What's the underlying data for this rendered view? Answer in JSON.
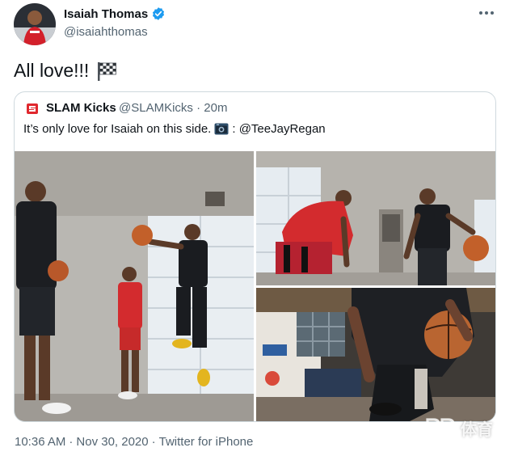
{
  "author": {
    "display_name": "Isaiah Thomas",
    "handle": "@isaiahthomas",
    "verified": true
  },
  "tweet": {
    "text": "All love!!!",
    "emoji_icon": "checkered-flag"
  },
  "quote": {
    "display_name": "SLAM Kicks",
    "handle": "@SLAMKicks",
    "separator": "·",
    "time": "20m",
    "text": "It’s only love for Isaiah on this side.",
    "credit": ": @TeeJayRegan"
  },
  "footer": {
    "time": "10:36 AM",
    "separator1": "·",
    "date": "Nov 30, 2020",
    "separator2": "·",
    "source": "Twitter for iPhone"
  },
  "watermark": {
    "text": "体育"
  },
  "colors": {
    "verified_blue": "#1d9bf0",
    "text_primary": "#0f1419",
    "text_secondary": "#536471",
    "border": "#cfd9de",
    "slam_red": "#e0282e"
  }
}
